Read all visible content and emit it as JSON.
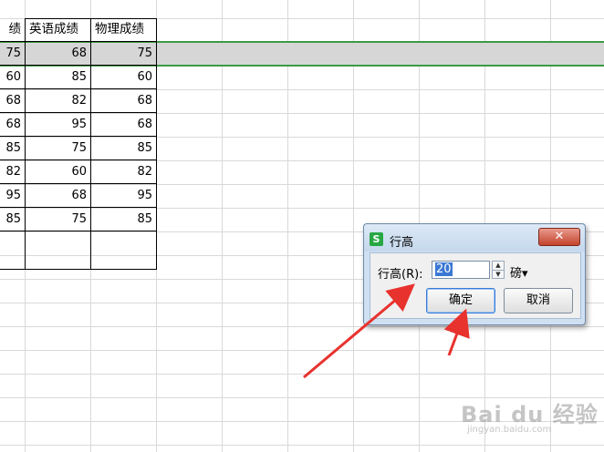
{
  "table": {
    "headers": [
      "绩",
      "英语成绩",
      "物理成绩"
    ],
    "rows": [
      [
        "75",
        "68",
        "75"
      ],
      [
        "60",
        "85",
        "60"
      ],
      [
        "68",
        "82",
        "68"
      ],
      [
        "68",
        "95",
        "68"
      ],
      [
        "85",
        "75",
        "85"
      ],
      [
        "82",
        "60",
        "82"
      ],
      [
        "95",
        "68",
        "95"
      ],
      [
        "85",
        "75",
        "85"
      ],
      [
        "",
        "",
        ""
      ]
    ]
  },
  "dialog": {
    "app_icon": "S",
    "title": "行高",
    "close_label": "✕",
    "field_label": "行高(R):",
    "value": "20",
    "unit": "磅▾",
    "ok_label": "确定",
    "cancel_label": "取消"
  },
  "watermark": {
    "main": "Bai du 经验",
    "sub": "jingyan.baidu.com"
  },
  "colors": {
    "selection_border": "#3c9a46",
    "selection_fill": "#d6d6d6",
    "arrow": "#e8322e"
  }
}
